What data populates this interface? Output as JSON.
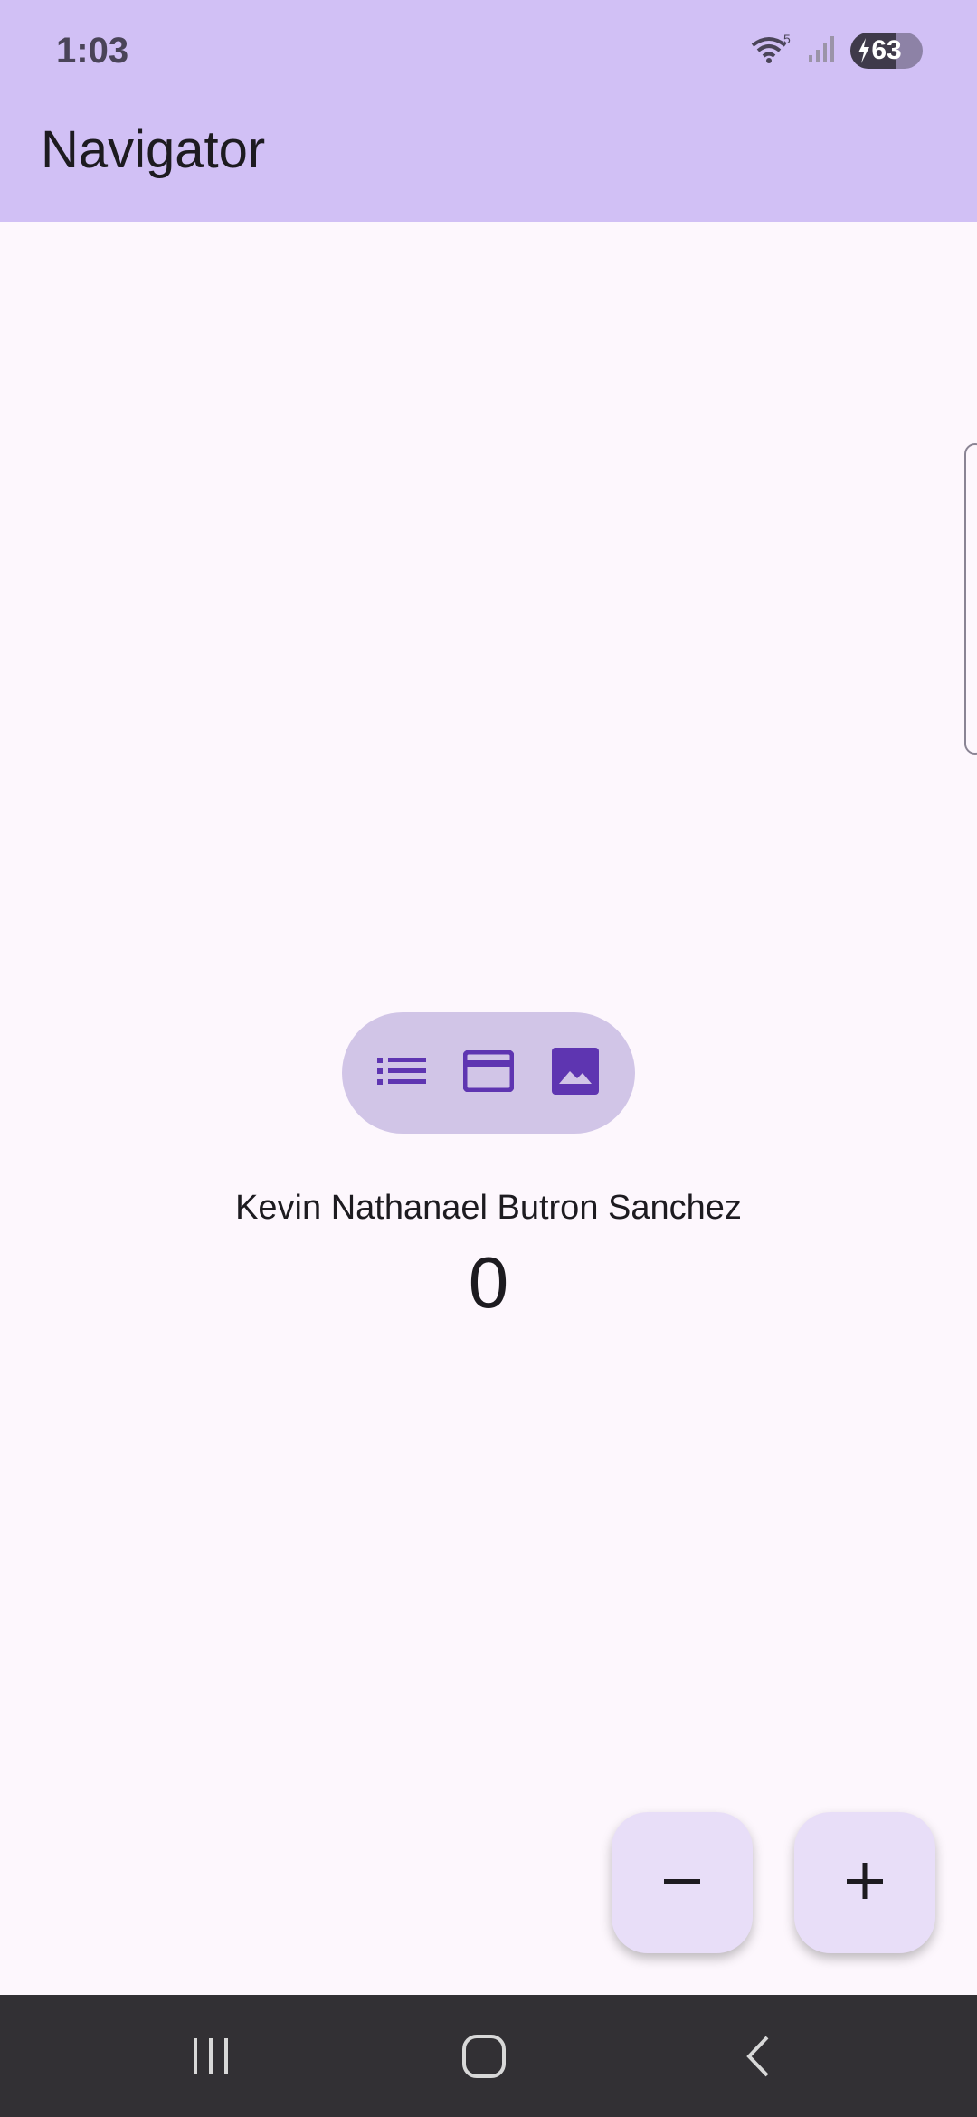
{
  "status_bar": {
    "time": "1:03",
    "battery_level": "63",
    "wifi_badge": "5",
    "icons": [
      "wifi-icon",
      "signal-icon",
      "battery-icon"
    ]
  },
  "app_bar": {
    "title": "Navigator",
    "background": "#d1c0f5"
  },
  "view_selector": {
    "options": [
      {
        "icon": "list-icon",
        "selected": false
      },
      {
        "icon": "card-icon",
        "selected": false
      },
      {
        "icon": "image-icon",
        "selected": true
      }
    ],
    "accent": "#5e35b1"
  },
  "content": {
    "name": "Kevin Nathanael Butron Sanchez",
    "counter": "0"
  },
  "fabs": {
    "decrement_icon": "minus-icon",
    "increment_icon": "plus-icon"
  },
  "nav_bar": {
    "buttons": [
      "recents-icon",
      "home-icon",
      "back-icon"
    ]
  }
}
